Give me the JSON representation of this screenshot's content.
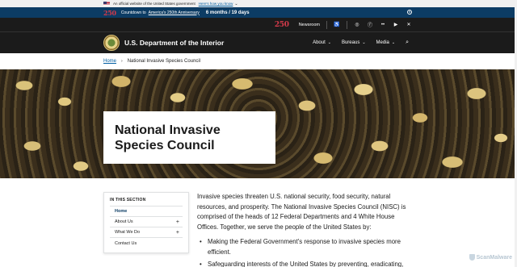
{
  "gov_banner": {
    "text": "An official website of the United States government",
    "link": "Here's how you know"
  },
  "countdown": {
    "logo": "250",
    "prefix": "Countdown to",
    "link": "America's 250th Anniversary",
    "time": "6 months  /  19 days"
  },
  "utility": {
    "logo": "250",
    "newsroom": "Newsroom",
    "icons": [
      "accessibility-icon",
      "instagram-icon",
      "facebook-icon",
      "flickr-icon",
      "youtube-icon",
      "x-icon"
    ]
  },
  "header": {
    "title": "U.S. Department of the Interior",
    "nav": [
      {
        "label": "About"
      },
      {
        "label": "Bureaus"
      },
      {
        "label": "Media"
      }
    ]
  },
  "breadcrumb": {
    "home": "Home",
    "current": "National Invasive Species Council"
  },
  "hero": {
    "title": "National Invasive Species Council"
  },
  "sidenav": {
    "heading": "IN THIS SECTION",
    "items": [
      {
        "label": "Home"
      },
      {
        "label": "About Us"
      },
      {
        "label": "What We Do"
      },
      {
        "label": "Contact Us"
      }
    ]
  },
  "body": {
    "intro": "Invasive species threaten U.S. national security, food security, natural resources, and prosperity. The National Invasive Species Council (NISC) is comprised of the heads of 12 Federal Departments and 4 White House Offices. Together, we serve the people of the United States by:",
    "bullets": [
      "Making the Federal Government's response to invasive species more efficient.",
      "Safeguarding interests of the United States by preventing, eradicating,"
    ]
  },
  "watermark": "ScanMalware"
}
